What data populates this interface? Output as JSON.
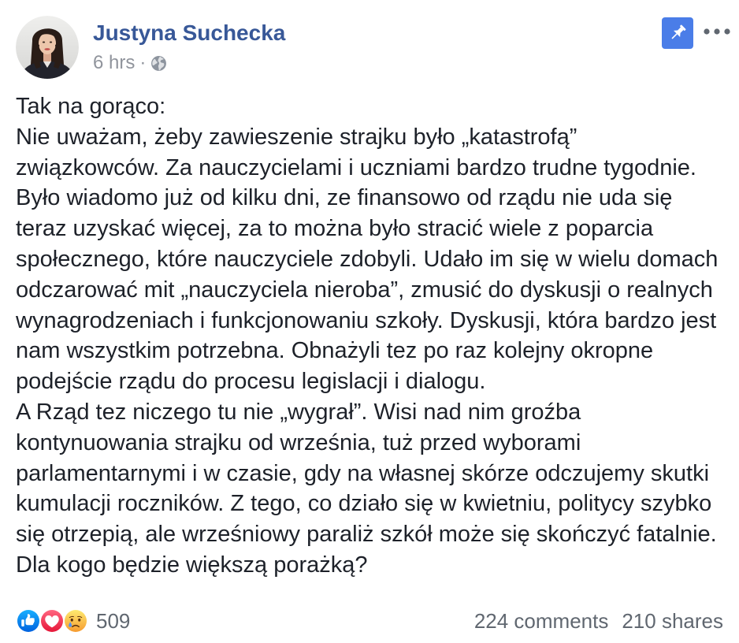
{
  "post": {
    "author": "Justyna Suchecka",
    "timestamp": "6 hrs",
    "separator": "·",
    "privacy_icon": "globe-icon",
    "pin_icon": "pin-icon",
    "more_icon": "more-options-icon",
    "body_lines": [
      "Tak na gorąco:",
      "Nie uważam, żeby zawieszenie strajku było „katastrofą”",
      "związkowców. Za nauczycielami i uczniami bardzo trudne tygodnie.",
      "Było wiadomo już od kilku dni, ze finansowo od rządu nie uda się",
      "teraz uzyskać więcej, za to można było stracić wiele z poparcia",
      "społecznego, które nauczyciele zdobyli. Udało im się w wielu domach",
      "odczarować mit „nauczyciela nieroba”, zmusić do dyskusji o realnych",
      "wynagrodzeniach i funkcjonowaniu szkoły. Dyskusji, która bardzo jest",
      "nam wszystkim potrzebna. Obnażyli tez po raz kolejny okropne",
      "podejście rządu do procesu legislacji i dialogu.",
      "A Rząd tez niczego tu nie „wygrał”. Wisi nad nim groźba",
      "kontynuowania strajku od września, tuż przed wyborami",
      "parlamentarnymi i w czasie, gdy na własnej skórze odczujemy skutki",
      "kumulacji roczników. Z tego, co działo się w kwietniu, politycy szybko",
      "się otrzepią, ale wrześniowy paraliż szkół może się skończyć fatalnie.",
      "Dla kogo będzie większą porażką?"
    ],
    "reactions": {
      "icons": [
        "like-icon",
        "love-icon",
        "sad-icon"
      ],
      "count": "509"
    },
    "comments": "224 comments",
    "shares": "210 shares"
  },
  "colors": {
    "author_link": "#385898",
    "body_text": "#1d2129",
    "meta_text": "#90949c",
    "footer_text": "#606770",
    "pin_button": "#4a7de8",
    "like": "#1877f2",
    "love": "#f33e58",
    "sad": "#f7b125"
  }
}
